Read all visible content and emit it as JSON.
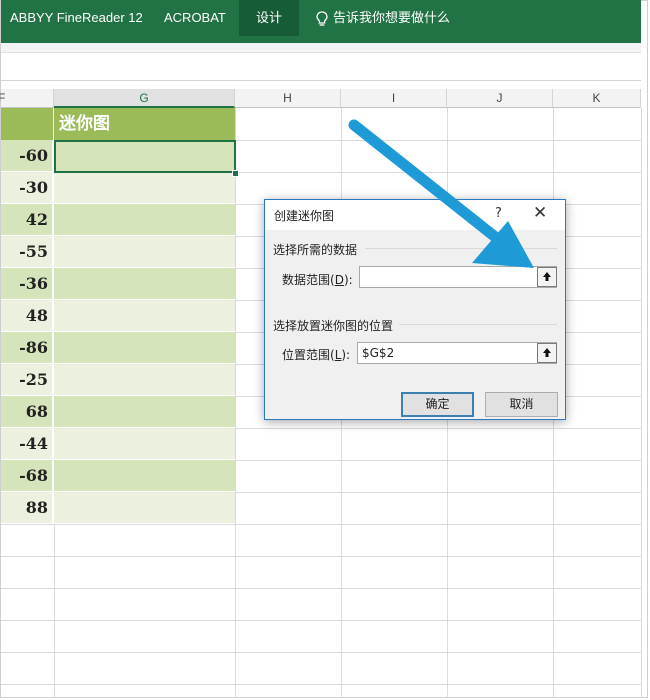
{
  "ribbon": {
    "tabs": [
      {
        "label": "ABBYY FineReader 12"
      },
      {
        "label": "ACROBAT"
      },
      {
        "label": "设计"
      }
    ],
    "tell_me": "告诉我你想要做什么"
  },
  "columns": {
    "partial": "F",
    "G": "G",
    "H": "H",
    "I": "I",
    "J": "J",
    "K": "K"
  },
  "sheet": {
    "header": "迷你图",
    "values": [
      "-60",
      "-30",
      "42",
      "-55",
      "-36",
      "48",
      "-86",
      "-25",
      "68",
      "-44",
      "-68",
      "88"
    ]
  },
  "dialog": {
    "title": "创建迷你图",
    "help": "?",
    "close": "✕",
    "section_data": "选择所需的数据",
    "data_range_label": "数据范围(",
    "data_range_key": "D",
    "data_range_suffix": "):",
    "data_range_value": "",
    "section_location": "选择放置迷你图的位置",
    "location_label": "位置范围(",
    "location_key": "L",
    "location_suffix": "):",
    "location_value": "$G$2",
    "ok": "确定",
    "cancel": "取消"
  },
  "colors": {
    "ribbon": "#217346",
    "header_fill": "#9bbb59",
    "band_dark": "#d6e4bc",
    "band_light": "#ebf1de",
    "arrow": "#1e9bd7"
  },
  "icons": {
    "tell_me": "lightbulb-icon",
    "collapse": "up-arrow-icon",
    "annotation": "blue-arrow-icon"
  }
}
